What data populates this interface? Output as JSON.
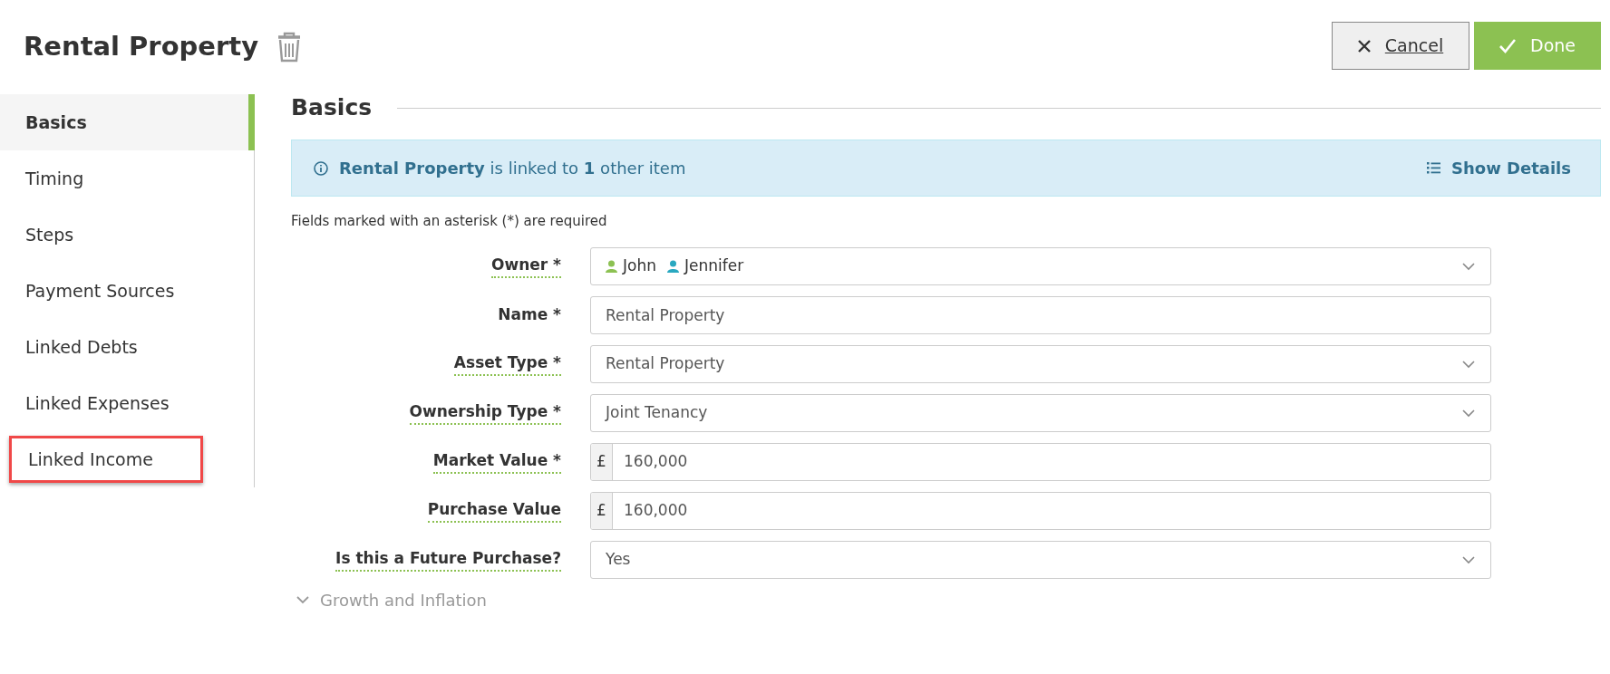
{
  "page_title": "Rental Property",
  "buttons": [
    {
      "kind": "cancel",
      "label": "Cancel"
    },
    {
      "kind": "done",
      "label": "Done"
    }
  ],
  "sidebar": {
    "items": [
      {
        "label": "Basics",
        "selected": true,
        "highlighted": false
      },
      {
        "label": "Timing",
        "selected": false,
        "highlighted": false
      },
      {
        "label": "Steps",
        "selected": false,
        "highlighted": false
      },
      {
        "label": "Payment Sources",
        "selected": false,
        "highlighted": false
      },
      {
        "label": "Linked Debts",
        "selected": false,
        "highlighted": false
      },
      {
        "label": "Linked Expenses",
        "selected": false,
        "highlighted": false
      },
      {
        "label": "Linked Income",
        "selected": false,
        "highlighted": true
      }
    ]
  },
  "section_title": "Basics",
  "info_banner": {
    "text": "**Rental Property** is linked to **1** other item",
    "action": "Show Details"
  },
  "required_note": "Fields marked with an asterisk (*) are required",
  "form": [
    {
      "label": "Owner *",
      "kind": "owners",
      "owners": [
        {
          "name": "John",
          "color": "#8cc152"
        },
        {
          "name": "Jennifer",
          "color": "#29a8c0"
        }
      ]
    },
    {
      "label": "Name *",
      "kind": "text",
      "value": "Rental Property"
    },
    {
      "label": "Asset Type *",
      "kind": "select",
      "value": "Rental Property"
    },
    {
      "label": "Ownership Type *",
      "kind": "select",
      "value": "Joint Tenancy"
    },
    {
      "label": "Market Value *",
      "kind": "currency",
      "prefix": "£",
      "value": "160,000"
    },
    {
      "label": "Purchase Value",
      "kind": "currency",
      "prefix": "£",
      "value": "160,000"
    },
    {
      "label": "Is this a Future Purchase?",
      "kind": "select",
      "value": "Yes"
    }
  ],
  "collapsed_section": "Growth and Inflation"
}
